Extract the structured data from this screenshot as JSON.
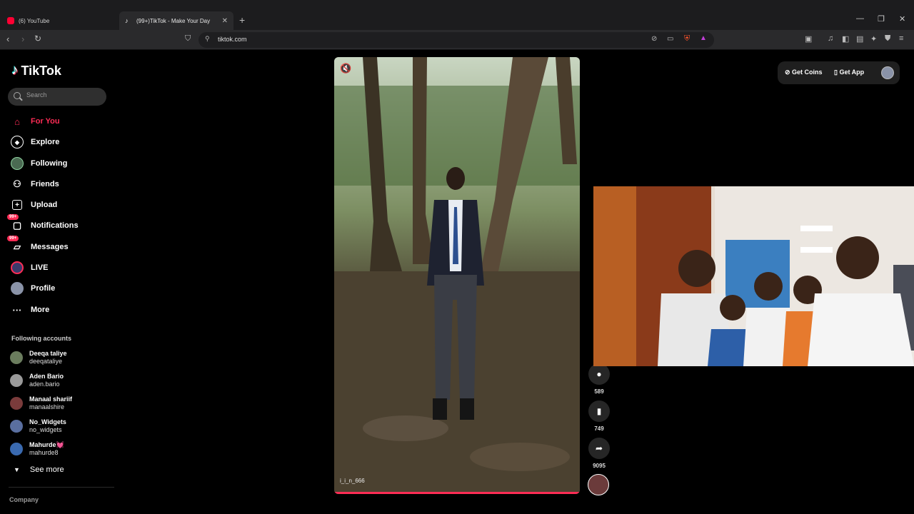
{
  "browser": {
    "tabs": [
      {
        "title": "(6) YouTube",
        "active": false
      },
      {
        "title": "(99+)TikTok - Make Your Day",
        "active": true
      }
    ],
    "url": "tiktok.com"
  },
  "app": {
    "logo": "TikTok",
    "search_placeholder": "Search"
  },
  "sidebar": {
    "items": [
      {
        "label": "For You",
        "icon": "home-icon",
        "active": true
      },
      {
        "label": "Explore",
        "icon": "compass-icon"
      },
      {
        "label": "Following",
        "icon": "following-avatar-icon"
      },
      {
        "label": "Friends",
        "icon": "friends-icon"
      },
      {
        "label": "Upload",
        "icon": "upload-icon"
      },
      {
        "label": "Notifications",
        "icon": "inbox-icon",
        "badge": "99+"
      },
      {
        "label": "Messages",
        "icon": "message-icon",
        "badge": "99+"
      },
      {
        "label": "LIVE",
        "icon": "live-icon"
      },
      {
        "label": "Profile",
        "icon": "profile-avatar-icon"
      },
      {
        "label": "More",
        "icon": "more-icon"
      }
    ],
    "following_title": "Following accounts",
    "accounts": [
      {
        "name": "Deeqa taliye",
        "handle": "deeqataliye"
      },
      {
        "name": "Aden Bario",
        "handle": "aden.bario"
      },
      {
        "name": "Manaal shariif",
        "handle": "manaalshire"
      },
      {
        "name": "No_Widgets",
        "handle": "no_widgets"
      },
      {
        "name": "Mahurde💓",
        "handle": "mahurde8"
      }
    ],
    "see_more": "See more",
    "company": "Company"
  },
  "header": {
    "get_coins": "Get Coins",
    "get_app": "Get App"
  },
  "video": {
    "caption": "i_i_n_666",
    "progress": 1.0
  },
  "actions": {
    "comments": "589",
    "saves": "749",
    "shares": "9095"
  },
  "colors": {
    "accent": "#fe2c55",
    "background": "#000000"
  }
}
